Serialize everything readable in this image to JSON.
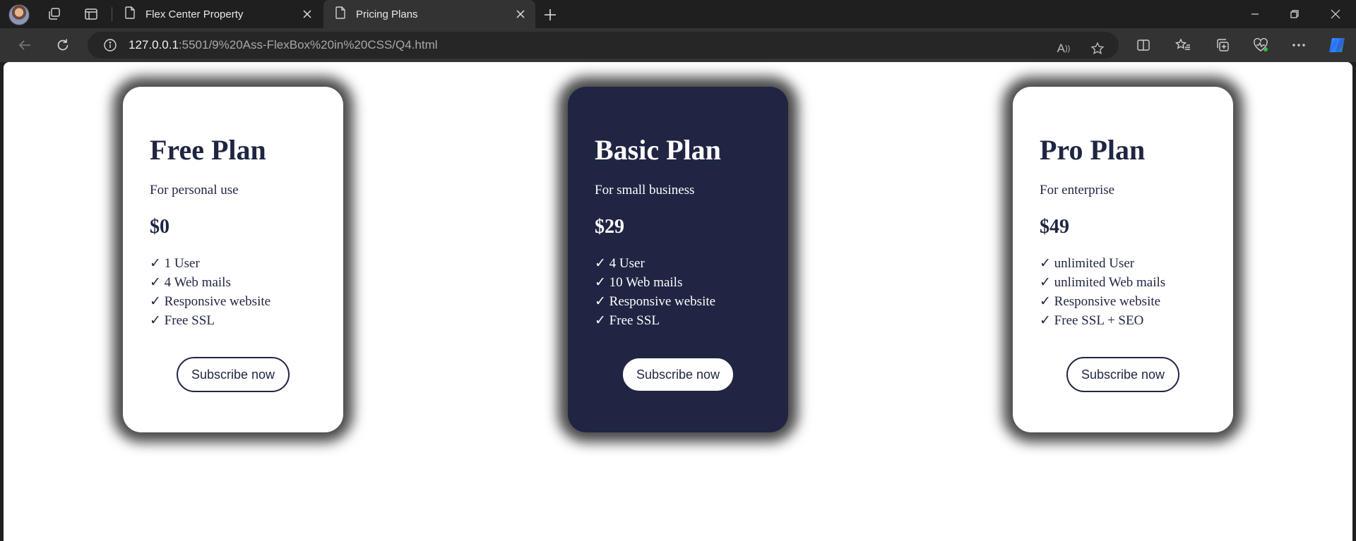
{
  "browser": {
    "tabs": [
      {
        "title": "Flex Center Property",
        "active": false
      },
      {
        "title": "Pricing Plans",
        "active": true
      }
    ],
    "address": {
      "host": "127.0.0.1",
      "path": ":5501/9%20Ass-FlexBox%20in%20CSS/Q4.html"
    },
    "accent": "#1f2542"
  },
  "plans": [
    {
      "name": "Free Plan",
      "description": "For personal use",
      "price": "$0",
      "features": [
        "✓ 1 User",
        "✓ 4 Web mails",
        "✓ Responsive website",
        "✓ Free SSL"
      ],
      "button": "Subscribe now",
      "theme": "light"
    },
    {
      "name": "Basic Plan",
      "description": "For small business",
      "price": "$29",
      "features": [
        "✓ 4 User",
        "✓ 10 Web mails",
        "✓ Responsive website",
        "✓ Free SSL"
      ],
      "button": "Subscribe now",
      "theme": "dark"
    },
    {
      "name": "Pro Plan",
      "description": "For enterprise",
      "price": "$49",
      "features": [
        "✓ unlimited User",
        "✓ unlimited Web mails",
        "✓ Responsive website",
        "✓ Free SSL + SEO"
      ],
      "button": "Subscribe now",
      "theme": "light"
    }
  ]
}
